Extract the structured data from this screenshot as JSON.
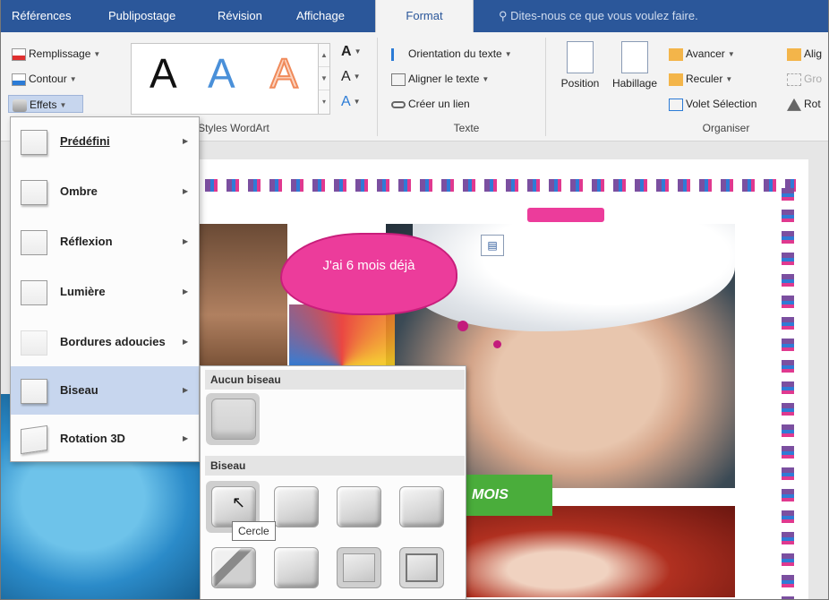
{
  "tabs": [
    "Références",
    "Publipostage",
    "Révision",
    "Affichage",
    "Format"
  ],
  "tell_me": "Dites-nous ce que vous voulez faire.",
  "ribbon": {
    "shape_styles": {
      "fill": "Remplissage",
      "outline": "Contour",
      "effects": "Effets"
    },
    "wordart": {
      "samples": [
        "A",
        "A",
        "A"
      ],
      "label": "Styles WordArt",
      "sample_colors": [
        "#111111",
        "#4a90d9",
        "#f4a07a"
      ]
    },
    "text_group": {
      "orientation": "Orientation du texte",
      "align": "Aligner le texte",
      "link": "Créer un lien",
      "label": "Texte"
    },
    "arrange": {
      "position": "Position",
      "wrap": "Habillage",
      "forward": "Avancer",
      "backward": "Reculer",
      "selection_pane": "Volet Sélection",
      "align": "Alig",
      "group": "Gro",
      "rotate": "Rot",
      "label": "Organiser"
    }
  },
  "effects_menu": [
    {
      "label": "Prédéfini",
      "icon": "preset-effect-icon"
    },
    {
      "label": "Ombre",
      "icon": "shadow-effect-icon"
    },
    {
      "label": "Réflexion",
      "icon": "reflection-effect-icon"
    },
    {
      "label": "Lumière",
      "icon": "glow-effect-icon"
    },
    {
      "label": "Bordures adoucies",
      "icon": "soft-edges-icon"
    },
    {
      "label": "Biseau",
      "icon": "bevel-effect-icon",
      "highlighted": true
    },
    {
      "label": "Rotation 3D",
      "icon": "rotation-3d-icon"
    }
  ],
  "bevel_submenu": {
    "no_bevel_header": "Aucun biseau",
    "bevel_header": "Biseau",
    "tooltip": "Cercle"
  },
  "document": {
    "cloud_text": "J'ai 6 mois déjà",
    "banner_text": "MOIS"
  },
  "colors": {
    "ribbon_blue": "#2b579a",
    "menu_highlight": "#c7d6ee",
    "callout_pink": "#ec3c9b",
    "banner_green": "#4aad3b"
  }
}
